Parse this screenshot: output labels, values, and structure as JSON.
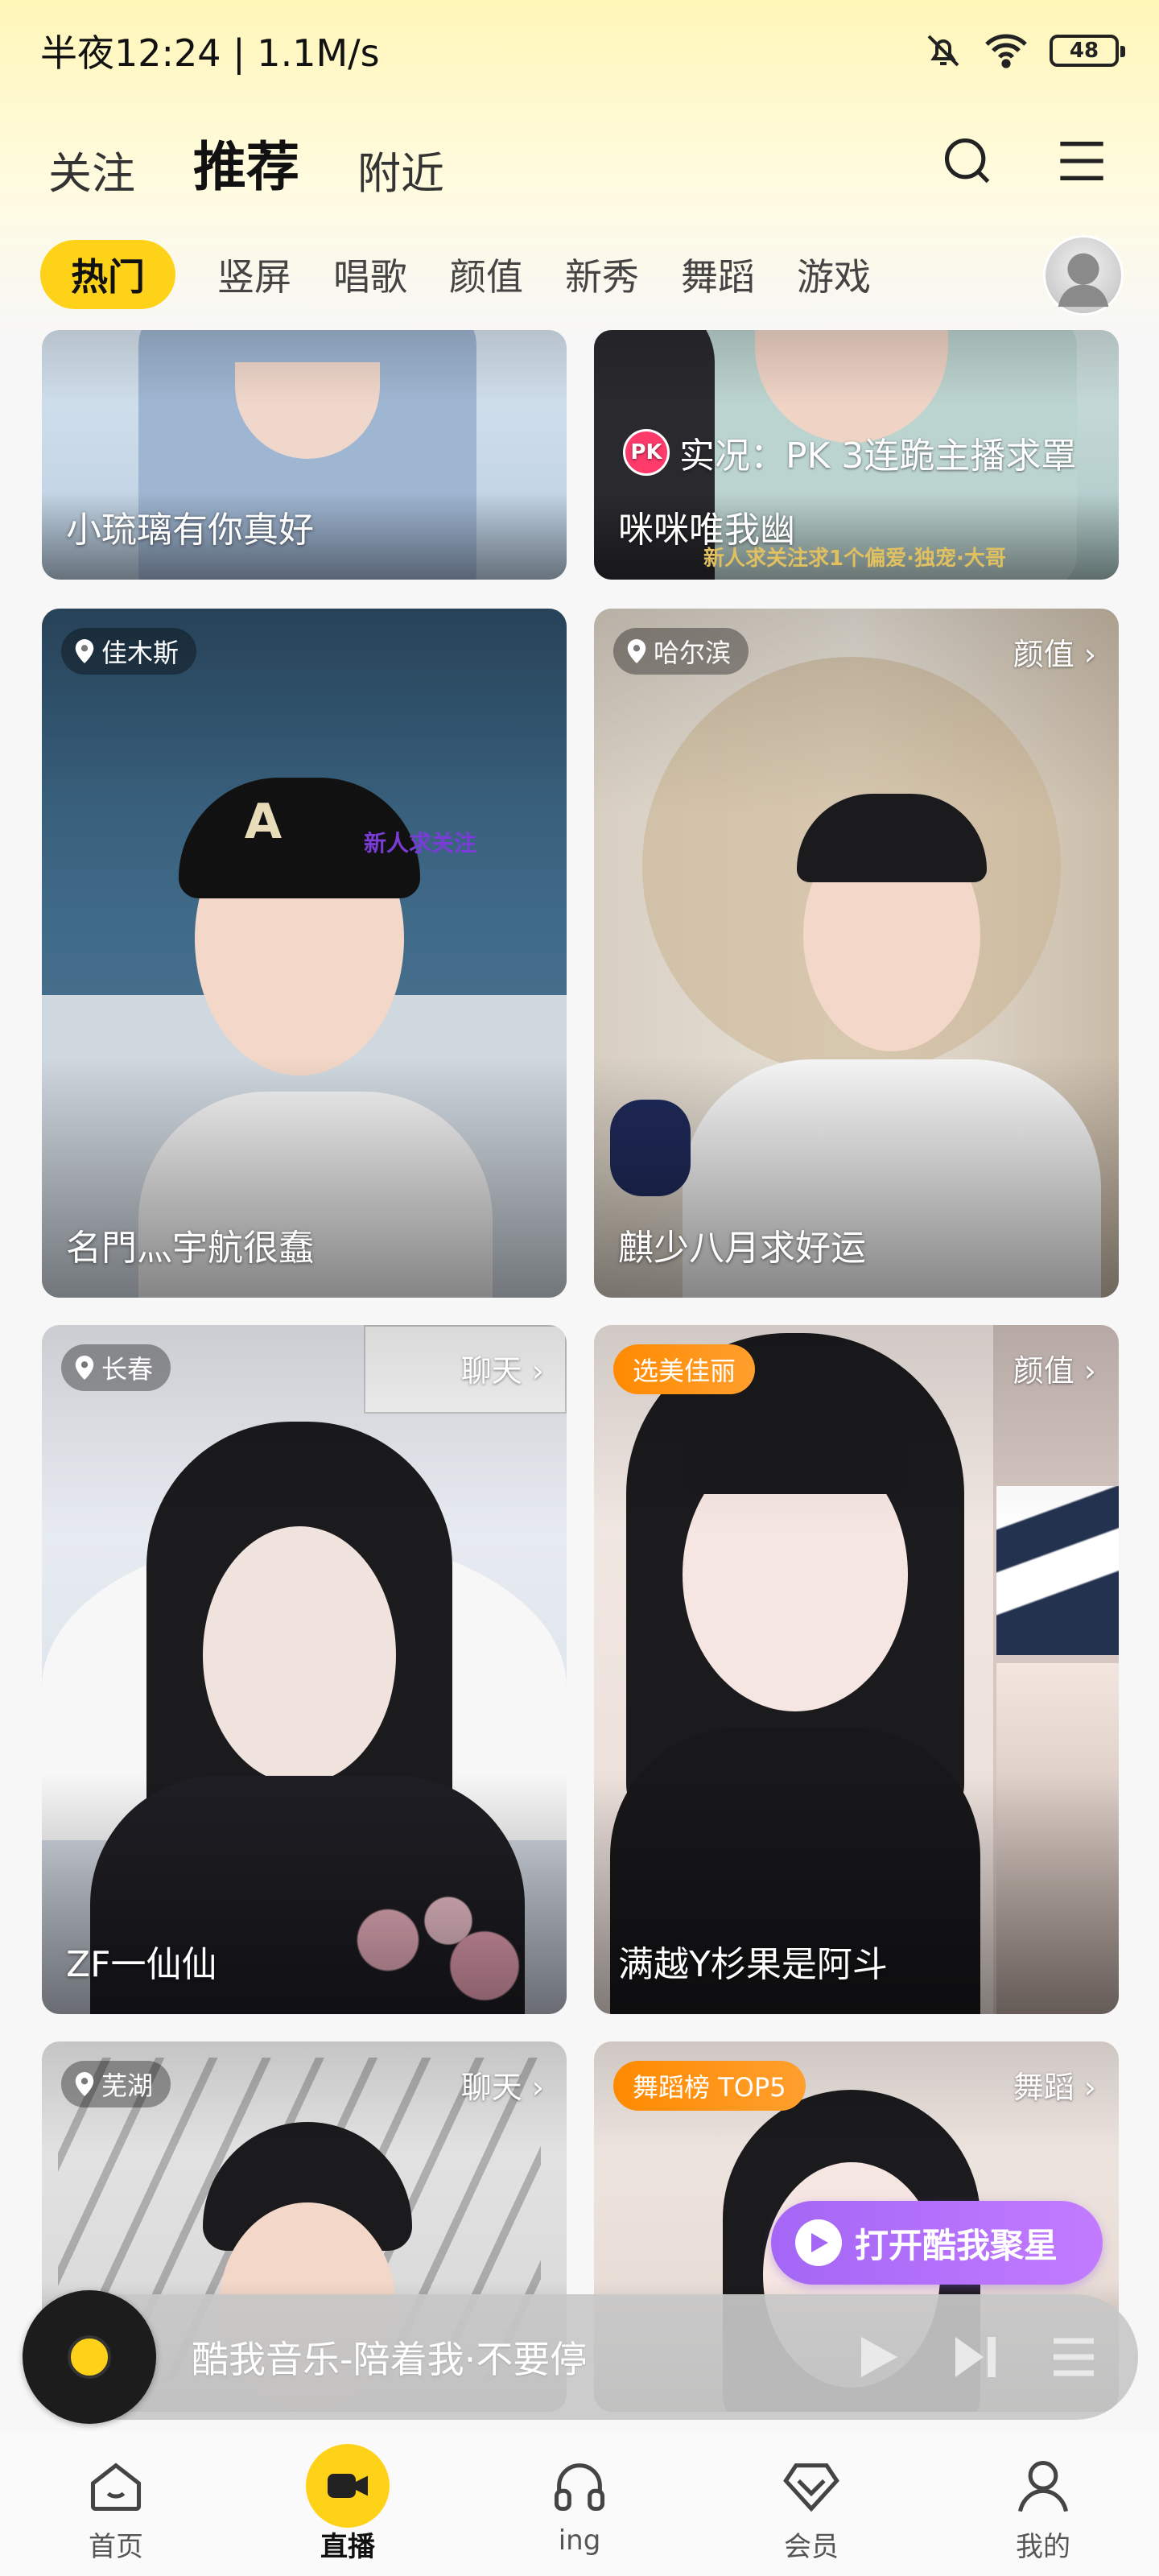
{
  "status_bar": {
    "time": "半夜12:24 | 1.1M/s",
    "battery": "48"
  },
  "top_tabs": [
    {
      "label": "关注"
    },
    {
      "label": "推荐"
    },
    {
      "label": "附近"
    }
  ],
  "categories": [
    {
      "label": "热门"
    },
    {
      "label": "竖屏"
    },
    {
      "label": "唱歌"
    },
    {
      "label": "颜值"
    },
    {
      "label": "新秀"
    },
    {
      "label": "舞蹈"
    },
    {
      "label": "游戏"
    }
  ],
  "cards": [
    {
      "title": "小琉璃有你真好"
    },
    {
      "title": "咪咪唯我幽",
      "pk_text": "实况：PK 3连跪主播求罩",
      "pk_badge": "PK",
      "overlay_text": "新人求关注求1个偏爱·独宠·大哥"
    },
    {
      "title": "名門灬宇航很蠢",
      "location": "佳木斯",
      "overlay_text": "新人求关注"
    },
    {
      "title": "麒少八月求好运",
      "location": "哈尔滨",
      "category": "颜值 ›"
    },
    {
      "title": "ZF一仙仙",
      "location": "长春",
      "category": "聊天 ›"
    },
    {
      "title": "满越Y杉果是阿斗",
      "rank": "选美佳丽",
      "category": "颜值 ›"
    },
    {
      "location": "芜湖",
      "category": "聊天 ›"
    },
    {
      "rank": "舞蹈榜 TOP5",
      "category": "舞蹈 ›"
    }
  ],
  "fab": {
    "label": "打开酷我聚星"
  },
  "music_bar": {
    "title": "酷我音乐-陪着我·不要停"
  },
  "bottom_nav": [
    {
      "label": "首页",
      "icon": "home-icon"
    },
    {
      "label": "直播",
      "icon": "live-camera-icon"
    },
    {
      "label": "ing",
      "icon": "headphones-icon"
    },
    {
      "label": "会员",
      "icon": "vip-diamond-icon"
    },
    {
      "label": "我的",
      "icon": "profile-icon"
    }
  ],
  "colors": {
    "accent": "#ffd21a",
    "fab": "#b070ff",
    "rank_tag": "#ff8a00"
  }
}
